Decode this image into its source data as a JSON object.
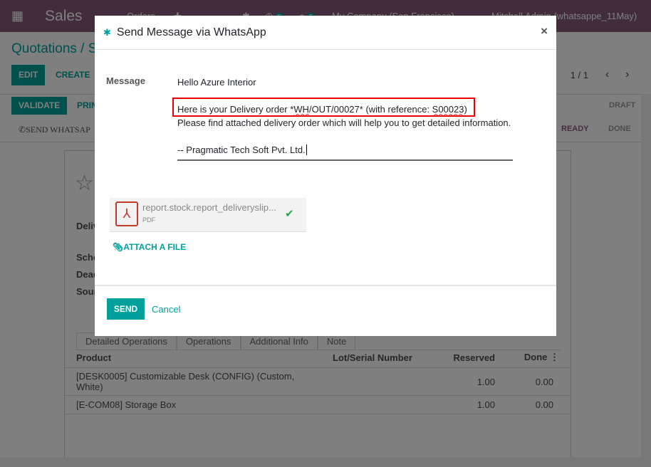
{
  "navbar": {
    "app": "Sales",
    "menu": "Orders",
    "activity_count": "5",
    "message_count": "5",
    "company": "My Company (San Francisco)",
    "user": "Mitchell Admin (whatsappe_11May)"
  },
  "breadcrumb": "Quotations / S",
  "buttons": {
    "edit": "EDIT",
    "create": "CREATE",
    "validate": "VALIDATE",
    "print": "PRIN",
    "send_whatsapp": "SEND WHATSAP"
  },
  "pager": "1 / 1",
  "statuses": [
    "DRAFT",
    "READY",
    "DONE"
  ],
  "form_fragments": [
    "Deliv",
    "Sche",
    "Dead",
    "Sour"
  ],
  "tabs": [
    "Detailed Operations",
    "Operations",
    "Additional Info",
    "Note"
  ],
  "table": {
    "headers": [
      "Product",
      "Lot/Serial Number",
      "Reserved",
      "Done"
    ],
    "rows": [
      {
        "product": "[DESK0005] Customizable Desk (CONFIG) (Custom, White)",
        "lot": "",
        "reserved": "1.00",
        "done": "0.00"
      },
      {
        "product": "[E-COM08] Storage Box",
        "lot": "",
        "reserved": "1.00",
        "done": "0.00"
      }
    ]
  },
  "modal": {
    "title": "Send Message via WhatsApp",
    "close": "×",
    "message_label": "Message",
    "message_lines": {
      "l1": "Hello Azure Interior",
      "l3a": "Here is your Delivery order *",
      "l3b": "WH",
      "l3c": "/OUT/00027* (with reference: ",
      "l3d": "S00023",
      "l3e": ")",
      "l4": " Please find attached delivery order which will help you to get detailed information.",
      "l6": "--  Pragmatic Tech Soft Pvt. Ltd."
    },
    "attachment": {
      "name": "report.stock.report_deliveryslip...",
      "type": "PDF"
    },
    "attach_file": "ATTACH A FILE",
    "send": "SEND",
    "cancel": "Cancel"
  },
  "colors": {
    "accent": "#00a09d",
    "navbar": "#875a7b",
    "highlight": "#ee0000"
  }
}
